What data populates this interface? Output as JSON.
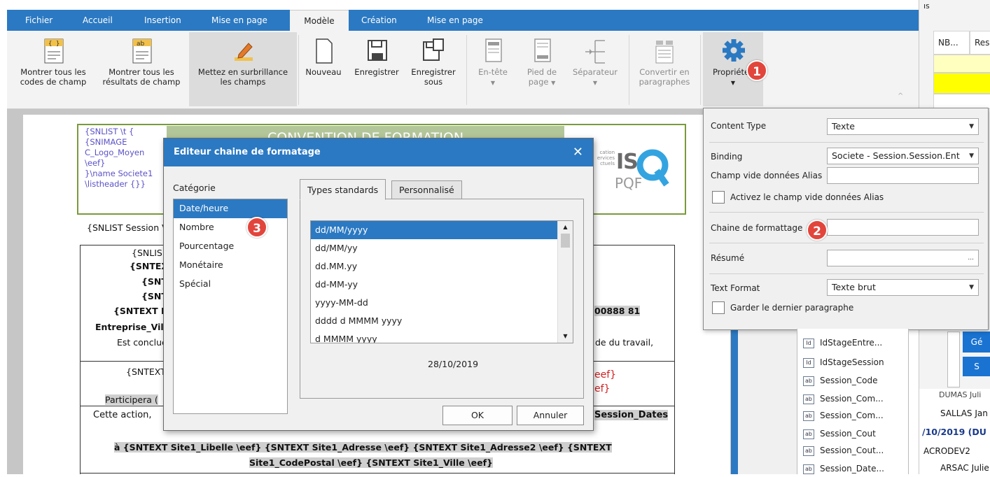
{
  "ribbon": {
    "tabs": [
      {
        "label": "Fichier"
      },
      {
        "label": "Accueil"
      },
      {
        "label": "Insertion"
      },
      {
        "label": "Mise en page"
      },
      {
        "label": "Modèle"
      },
      {
        "label": "Création"
      },
      {
        "label": "Mise en page"
      }
    ],
    "active_tab": "Modèle",
    "buttons": {
      "show_codes": {
        "line1": "Montrer tous les",
        "line2": "codes de champ"
      },
      "show_results": {
        "line1": "Montrer tous les",
        "line2": "résultats de champ"
      },
      "highlight": {
        "line1": "Mettez en surbrillance",
        "line2": "les champs"
      },
      "new": {
        "line1": "Nouveau"
      },
      "save": {
        "line1": "Enregistrer"
      },
      "save_as": {
        "line1": "Enregistrer",
        "line2": "sous"
      },
      "header": {
        "line1": "En-tête"
      },
      "footer": {
        "line1": "Pied de",
        "line2": "page"
      },
      "separator": {
        "line1": "Séparateur"
      },
      "convert": {
        "line1": "Convertir en",
        "line2": "paragraphes"
      },
      "properties": {
        "line1": "Propriétés"
      }
    }
  },
  "right_strip": {
    "top_label": "ıs",
    "col1": "NB...",
    "col2": "Res",
    "btn1": "Gé",
    "btn2": "S",
    "names": [
      "DUMAS Juli",
      "SALLAS Jan",
      "/10/2019 (DU",
      "ACRODEV2",
      "ARSAC Julie"
    ]
  },
  "document": {
    "header_codes": [
      "{SNLIST \\t {",
      "{SNIMAGE",
      "C_Logo_Moyen",
      "\\eef}",
      "}\\name Societe1",
      "\\listheader {}}"
    ],
    "title": "CONVENTION DE FORMATION",
    "logo_small": [
      "cation",
      "ervices",
      "ctuels"
    ],
    "logo_is": "IS",
    "logo_pqf": "PQF",
    "snlist_session": "{SNLIST Session V",
    "rows": [
      "{SNLIS",
      "{SNTEX",
      "{SNT",
      "{SNT",
      "{SNTEXT E",
      "Entreprise_Vil",
      "Est conclue l",
      "{SNTEXT",
      "Participera (",
      "Cette action,"
    ],
    "right_frags": [
      "00888 81",
      "de du travail,",
      "eef}",
      "ef}",
      "Session_Dates"
    ],
    "line_site": "à {SNTEXT Site1_Libelle \\eef} {SNTEXT Site1_Adresse \\eef} {SNTEXT Site1_Adresse2 \\eef} {SNTEXT",
    "line_site2": "Site1_CodePostal \\eef} {SNTEXT Site1_Ville \\eef}"
  },
  "dialog": {
    "title": "Editeur chaine de formatage",
    "close": "✕",
    "category_label": "Catégorie",
    "categories": [
      "Date/heure",
      "Nombre",
      "Pourcentage",
      "Monétaire",
      "Spécial"
    ],
    "selected_category": "Date/heure",
    "tabs": [
      "Types standards",
      "Personnalisé"
    ],
    "formats": [
      "dd/MM/yyyy",
      "dd/MM/yy",
      "dd.MM.yy",
      "dd-MM-yy",
      "yyyy-MM-dd",
      "dddd d MMMM yyyy",
      "d MMMM yyyy"
    ],
    "selected_format": "dd/MM/yyyy",
    "preview": "28/10/2019",
    "ok": "OK",
    "cancel": "Annuler"
  },
  "properties": {
    "content_type_label": "Content Type",
    "content_type_value": "Texte",
    "binding_label": "Binding",
    "binding_value": "Societe - Session.Session.Ent",
    "alias_label": "Champ vide données Alias",
    "alias_value": "",
    "activate_alias_label": "Activez le champ vide données Alias",
    "format_string_label": "Chaine de formattage",
    "format_string_value": "",
    "summary_label": "Résumé",
    "summary_value": "",
    "summary_btn": "...",
    "text_format_label": "Text Format",
    "text_format_value": "Texte brut",
    "keep_last_label": "Garder le dernier paragraphe"
  },
  "field_list": [
    {
      "tag": "Id",
      "name": "IdStageEntre..."
    },
    {
      "tag": "Id",
      "name": "IdStageSession"
    },
    {
      "tag": "ab",
      "name": "Session_Code"
    },
    {
      "tag": "ab",
      "name": "Session_Com..."
    },
    {
      "tag": "ab",
      "name": "Session_Com..."
    },
    {
      "tag": "ab",
      "name": "Session_Cout"
    },
    {
      "tag": "ab",
      "name": "Session_Cout..."
    },
    {
      "tag": "ab",
      "name": "Session_Date..."
    }
  ],
  "badges": [
    "1",
    "2",
    "3"
  ],
  "colors": {
    "accent": "#2b79c2",
    "badge": "#e2453c",
    "title_bar": "#b3c69a",
    "yellow": "#ffff00"
  }
}
